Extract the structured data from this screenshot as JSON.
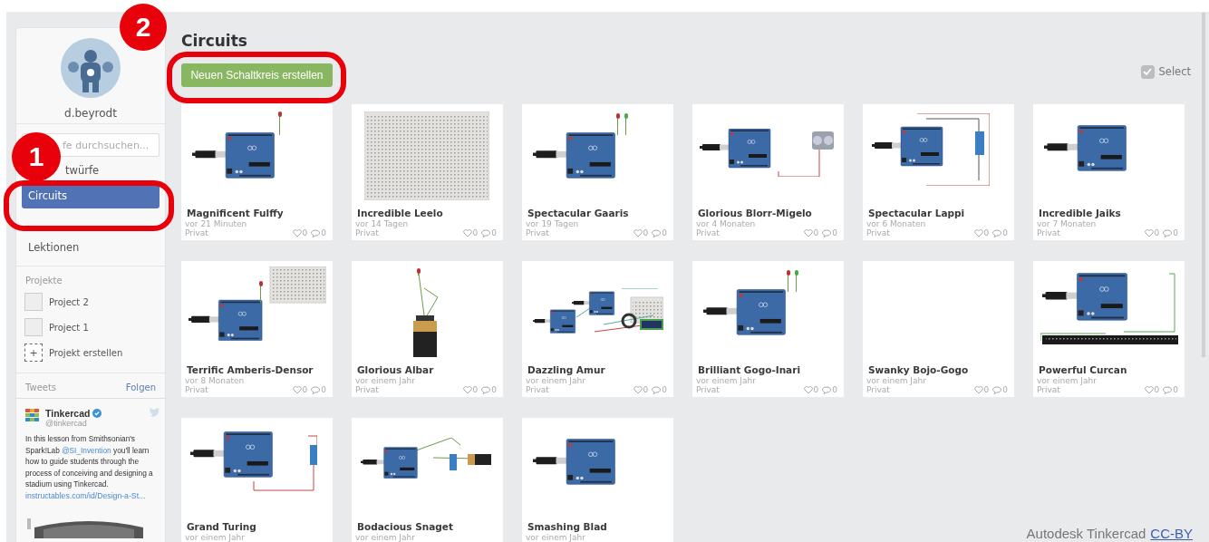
{
  "sidebar": {
    "user": {
      "name": "d.beyrodt"
    },
    "search": {
      "placeholder": "fe durchsuchen..."
    },
    "nav": [
      {
        "label": "twürfe",
        "selected": false
      },
      {
        "label": "Circuits",
        "selected": true
      },
      {
        "label": "Lektionen",
        "selected": false
      }
    ],
    "projects": {
      "heading": "Projekte",
      "items": [
        {
          "name": "Project 2"
        },
        {
          "name": "Project 1"
        }
      ],
      "create_icon": "+",
      "create": "Projekt erstellen"
    },
    "tweets": {
      "heading": "Tweets",
      "follow": "Folgen",
      "tweet": {
        "author": "Tinkercad",
        "handle": "@tinkercad",
        "text": [
          {
            "kind": "plain",
            "text": "In this lesson from Smithsonian's Spark!Lab "
          },
          {
            "kind": "mention",
            "text": "@SI_Invention"
          },
          {
            "kind": "plain",
            "text": " you'll learn how to guide students through the process of conceiving and designing a stadium using Tinkercad."
          }
        ],
        "link": "instructables.com/id/Design-a-St..."
      }
    }
  },
  "main": {
    "title": "Circuits",
    "new_button": "Neuen Schaltkreis erstellen",
    "select": {
      "label": "Select",
      "checked": true
    },
    "cards": [
      {
        "name": "Magnificent Fulffy",
        "time": "vor 21 Minuten",
        "visibility": "Privat",
        "likes": "0",
        "comments": "0",
        "thumbnail": {
          "kind": "arduino_led"
        }
      },
      {
        "name": "Incredible Leelo",
        "time": "vor 14 Tagen",
        "visibility": "Privat",
        "likes": "0",
        "comments": "0",
        "thumbnail": {
          "kind": "breadboard"
        }
      },
      {
        "name": "Spectacular Gaaris",
        "time": "vor 19 Tagen",
        "visibility": "Privat",
        "likes": "0",
        "comments": "0",
        "thumbnail": {
          "kind": "arduino_2led"
        }
      },
      {
        "name": "Glorious Blorr-Migelo",
        "time": "vor 4 Monaten",
        "visibility": "Privat",
        "likes": "0",
        "comments": "0",
        "thumbnail": {
          "kind": "sensor"
        }
      },
      {
        "name": "Spectacular Lappi",
        "time": "vor 6 Monaten",
        "visibility": "Privat",
        "likes": "0",
        "comments": "0",
        "thumbnail": {
          "kind": "servo"
        }
      },
      {
        "name": "Incredible Jaiks",
        "time": "vor 7 Monaten",
        "visibility": "Privat",
        "likes": "0",
        "comments": "0",
        "thumbnail": {
          "kind": "arduino"
        }
      },
      {
        "name": "Terrific Amberis-Densor",
        "time": "vor 8 Monaten",
        "visibility": "Privat",
        "likes": "0",
        "comments": "0",
        "thumbnail": {
          "kind": "breadboard_led"
        }
      },
      {
        "name": "Glorious Albar",
        "time": "vor einem Jahr",
        "visibility": "Privat",
        "likes": "0",
        "comments": "0",
        "thumbnail": {
          "kind": "battery"
        }
      },
      {
        "name": "Dazzling Amur",
        "time": "vor einem Jahr",
        "visibility": "Privat",
        "likes": "0",
        "comments": "0",
        "thumbnail": {
          "kind": "multi"
        }
      },
      {
        "name": "Brilliant Gogo-Inari",
        "time": "vor einem Jahr",
        "visibility": "Privat",
        "likes": "0",
        "comments": "0",
        "thumbnail": {
          "kind": "arduino_2led"
        }
      },
      {
        "name": "Swanky Bojo-Gogo",
        "time": "vor einem Jahr",
        "visibility": "Privat",
        "likes": "0",
        "comments": "0",
        "thumbnail": {
          "kind": "empty"
        }
      },
      {
        "name": "Powerful Curcan",
        "time": "vor einem Jahr",
        "visibility": "Privat",
        "likes": "0",
        "comments": "0",
        "thumbnail": {
          "kind": "strip"
        }
      },
      {
        "name": "Grand Turing",
        "time": "vor einem Jahr",
        "thumbnail": {
          "kind": "servo_wires"
        }
      },
      {
        "name": "Bodacious Snaget",
        "time": "vor einem Jahr",
        "thumbnail": {
          "kind": "battery_board"
        }
      },
      {
        "name": "Smashing Blad",
        "time": "vor einem Jahr",
        "thumbnail": {
          "kind": "arduino"
        }
      }
    ]
  },
  "annotations": [
    {
      "number": "1"
    },
    {
      "number": "2"
    }
  ],
  "footer": {
    "credit": "Autodesk Tinkercad",
    "license": "CC-BY"
  }
}
